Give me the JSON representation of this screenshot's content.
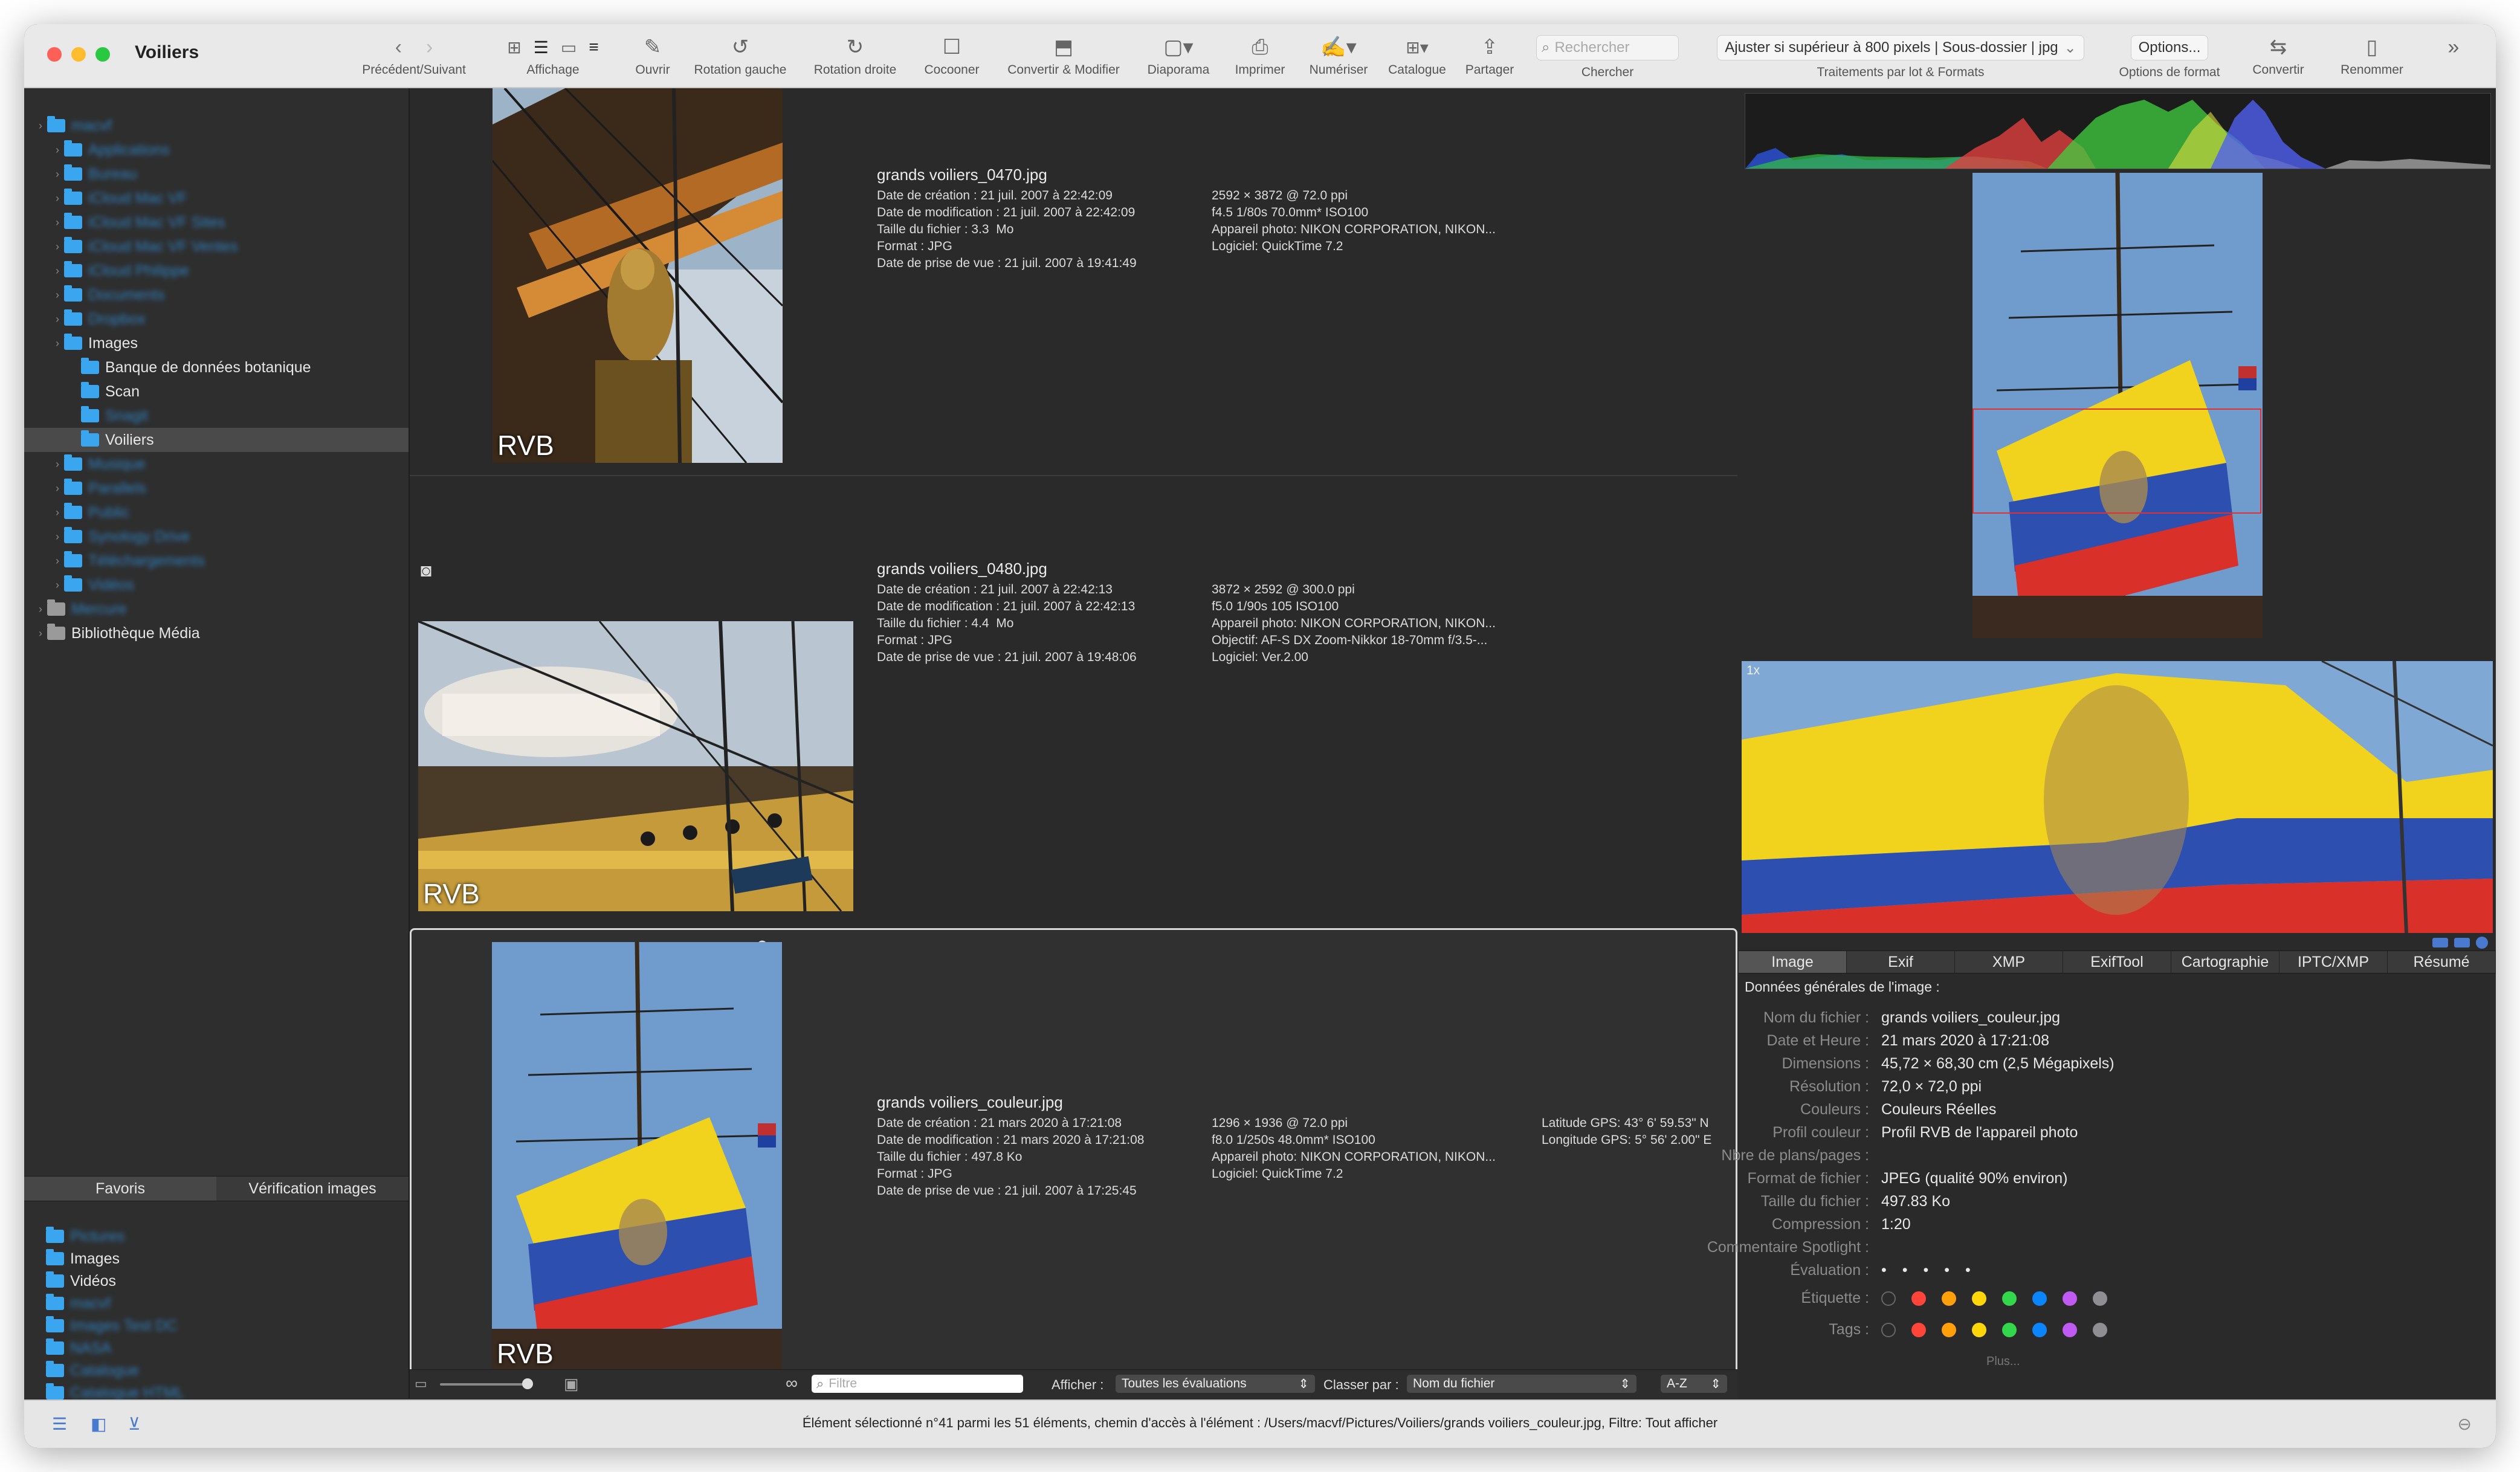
{
  "window": {
    "title": "Voiliers"
  },
  "toolbar": {
    "nav_label": "Précédent/Suivant",
    "view_label": "Affichage",
    "open_label": "Ouvrir",
    "rotate_left_label": "Rotation gauche",
    "rotate_right_label": "Rotation droite",
    "tag_label": "Cocooner",
    "convert_modify_label": "Convertir & Modifier",
    "slideshow_label": "Diaporama",
    "print_label": "Imprimer",
    "scan_label": "Numériser",
    "catalog_label": "Catalogue",
    "share_label": "Partager",
    "search_placeholder": "Rechercher",
    "search_label": "Chercher",
    "batch_value": "Ajuster si supérieur à 800 pixels | Sous-dossier | jpg",
    "batch_label": "Traitements par lot & Formats",
    "options_value": "Options...",
    "options_label": "Options de format",
    "convert_label": "Convertir",
    "rename_label": "Renommer"
  },
  "sidebar": {
    "tree": [
      {
        "label": "macvf",
        "indent": 0,
        "blur": true
      },
      {
        "label": "Applications",
        "indent": 1,
        "blur": true
      },
      {
        "label": "Bureau",
        "indent": 1,
        "blur": true
      },
      {
        "label": "iCloud Mac VF",
        "indent": 1,
        "blur": true
      },
      {
        "label": "iCloud Mac VF Sites",
        "indent": 1,
        "blur": true
      },
      {
        "label": "iCloud Mac VF Ventes",
        "indent": 1,
        "blur": true
      },
      {
        "label": "iCloud Philippe",
        "indent": 1,
        "blur": true
      },
      {
        "label": "Documents",
        "indent": 1,
        "blur": true
      },
      {
        "label": "Dropbox",
        "indent": 1,
        "blur": true
      },
      {
        "label": "Images",
        "indent": 1,
        "blur": false
      },
      {
        "label": "Banque de données botanique",
        "indent": 2,
        "blur": false
      },
      {
        "label": "Scan",
        "indent": 2,
        "blur": false
      },
      {
        "label": "Snagit",
        "indent": 2,
        "blur": true
      },
      {
        "label": "Voiliers",
        "indent": 2,
        "blur": false,
        "selected": true
      },
      {
        "label": "Musique",
        "indent": 1,
        "blur": true
      },
      {
        "label": "Parallels",
        "indent": 1,
        "blur": true
      },
      {
        "label": "Public",
        "indent": 1,
        "blur": true
      },
      {
        "label": "Synology Drive",
        "indent": 1,
        "blur": true
      },
      {
        "label": "Téléchargements",
        "indent": 1,
        "blur": true
      },
      {
        "label": "Vidéos",
        "indent": 1,
        "blur": true
      },
      {
        "label": "Mercure",
        "indent": 0,
        "blur": true
      },
      {
        "label": "Bibliothèque Média",
        "indent": 0,
        "blur": false
      }
    ],
    "tabs": [
      "Favoris",
      "Vérification images"
    ],
    "favorites": [
      {
        "label": "Pictures",
        "blur": true
      },
      {
        "label": "Images",
        "blur": false
      },
      {
        "label": "Vidéos",
        "blur": false
      },
      {
        "label": "macvf",
        "blur": true
      },
      {
        "label": "Images Test DC",
        "blur": true
      },
      {
        "label": "NASA",
        "blur": true
      },
      {
        "label": "Catalogue",
        "blur": true
      },
      {
        "label": "Catalogue HTML",
        "blur": true
      }
    ]
  },
  "files": [
    {
      "name": "grands voiliers_0470.jpg",
      "col1": "Date de création : 21 juil. 2007 à 22:42:09\nDate de modification : 21 juil. 2007 à 22:42:09\nTaille du fichier : 3.3  Mo\nFormat : JPG\nDate de prise de vue : 21 juil. 2007 à 19:41:49",
      "col2": "2592 × 3872 @ 72.0 ppi\nf4.5 1/80s 70.0mm* ISO100\nAppareil photo: NIKON CORPORATION, NIKON...\nLogiciel: QuickTime 7.2",
      "col3": "",
      "badge": "RVB"
    },
    {
      "name": "grands voiliers_0480.jpg",
      "col1": "Date de création : 21 juil. 2007 à 22:42:13\nDate de modification : 21 juil. 2007 à 22:42:13\nTaille du fichier : 4.4  Mo\nFormat : JPG\nDate de prise de vue : 21 juil. 2007 à 19:48:06",
      "col2": "3872 × 2592 @ 300.0 ppi\nf5.0 1/90s 105 ISO100\nAppareil photo: NIKON CORPORATION, NIKON...\nObjectif: AF-S DX Zoom-Nikkor 18-70mm f/3.5-...\nLogiciel: Ver.2.00",
      "col3": "",
      "badge": "RVB"
    },
    {
      "name": "grands voiliers_couleur.jpg",
      "col1": "Date de création : 21 mars 2020 à 17:21:08\nDate de modification : 21 mars 2020 à 17:21:08\nTaille du fichier : 497.8 Ko\nFormat : JPG\nDate de prise de vue : 21 juil. 2007 à 17:25:45",
      "col2": "1296 × 1936 @ 72.0 ppi\nf8.0 1/250s 48.0mm* ISO100\nAppareil photo: NIKON CORPORATION, NIKON...\nLogiciel: QuickTime 7.2",
      "col3": "Latitude GPS: 43° 6' 59.53\" N\nLongitude GPS: 5° 56' 2.00\" E",
      "badge": "RVB"
    }
  ],
  "bottom": {
    "filter_placeholder": "Filtre",
    "show_label": "Afficher :",
    "show_value": "Toutes les évaluations",
    "sort_label": "Classer par :",
    "sort_value": "Nom du fichier",
    "order_value": "A-Z"
  },
  "preview": {
    "zoom_label": "1x"
  },
  "info": {
    "tabs": [
      "Image",
      "Exif",
      "XMP",
      "ExifTool",
      "Cartographie",
      "IPTC/XMP",
      "Résumé"
    ],
    "section_title": "Données générales de l'image :",
    "rows": [
      {
        "k": "Nom du fichier :",
        "v": "grands voiliers_couleur.jpg"
      },
      {
        "k": "Date et Heure :",
        "v": "21 mars 2020 à 17:21:08"
      },
      {
        "k": "Dimensions :",
        "v": "45,72 × 68,30 cm (2,5 Mégapixels)"
      },
      {
        "k": "Résolution :",
        "v": "72,0 × 72,0 ppi"
      },
      {
        "k": "Couleurs :",
        "v": "Couleurs Réelles"
      },
      {
        "k": "Profil couleur :",
        "v": "Profil RVB de l'appareil photo"
      },
      {
        "k": "Nbre de plans/pages :",
        "v": ""
      },
      {
        "k": "Format de fichier :",
        "v": "JPEG (qualité 90% environ)"
      },
      {
        "k": "Taille du fichier :",
        "v": "497.83 Ko"
      },
      {
        "k": "Compression :",
        "v": "1:20"
      },
      {
        "k": "Commentaire Spotlight :",
        "v": ""
      }
    ],
    "rating_label": "Évaluation :",
    "label_label": "Étiquette :",
    "tags_label": "Tags :",
    "more_label": "Plus...",
    "label_colors": [
      "#ff453a",
      "#ff9f0a",
      "#ffd60a",
      "#32d74b",
      "#0a84ff",
      "#bf5af2",
      "#8e8e93"
    ]
  },
  "status": {
    "text": "Élément sélectionné n°41 parmi les 51 éléments, chemin d'accès à l'élément : /Users/macvf/Pictures/Voiliers/grands voiliers_couleur.jpg, Filtre: Tout afficher"
  }
}
